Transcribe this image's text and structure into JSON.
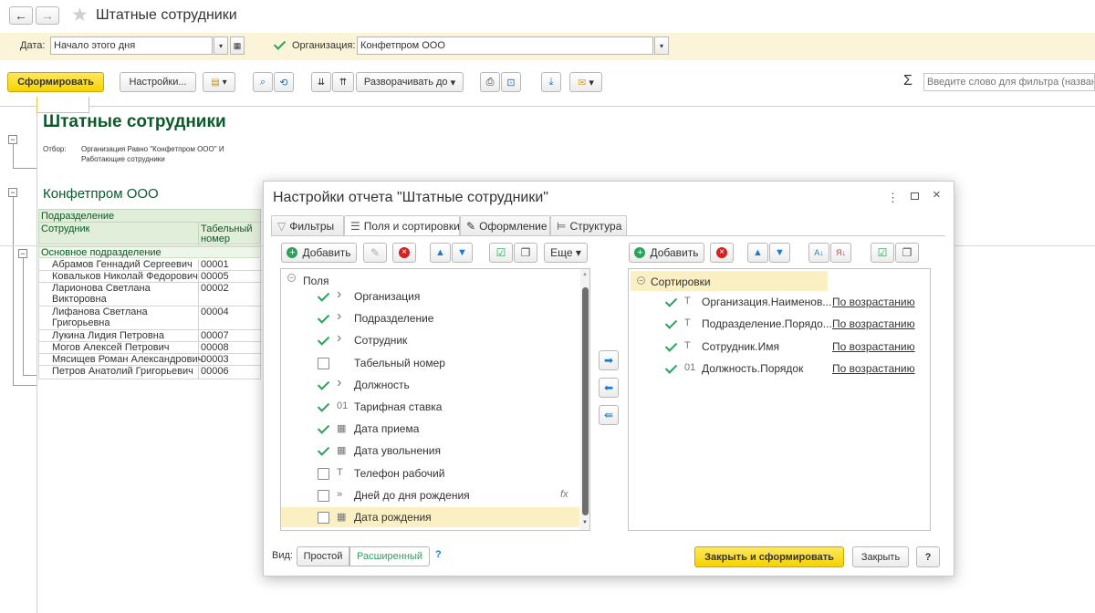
{
  "window": {
    "title": "Штатные сотрудники"
  },
  "params": {
    "date_label": "Дата:",
    "date_value": "Начало этого дня",
    "org_label": "Организация:",
    "org_value": "Конфетпром ООО"
  },
  "toolbar": {
    "generate": "Сформировать",
    "settings": "Настройки...",
    "expand_to": "Разворачивать до",
    "filter_placeholder": "Введите слово для фильтра (названи",
    "sigma": "Σ"
  },
  "report": {
    "title": "Штатные сотрудники",
    "filter_label": "Отбор:",
    "filter_line1": "Организация Равно \"Конфетпром ООО\" И",
    "filter_line2": "Работающие сотрудники",
    "org_header": "Конфетпром ООО",
    "col_dept": "Подразделение",
    "col_employee": "Сотрудник",
    "col_tabnum_1": "Табельный",
    "col_tabnum_2": "номер",
    "dept_name": "Основное подразделение",
    "rows": [
      {
        "name": "Абрамов Геннадий Сергеевич",
        "num": "00001"
      },
      {
        "name": "Ковальков Николай Федорович",
        "num": "00005"
      },
      {
        "name": "Ларионова Светлана",
        "name2": "Викторовна",
        "num": "00002"
      },
      {
        "name": "Лифанова Светлана",
        "name2": "Григорьевна",
        "num": "00004"
      },
      {
        "name": "Лукина Лидия Петровна",
        "num": "00007"
      },
      {
        "name": "Могов Алексей Петрович",
        "num": "00008"
      },
      {
        "name": "Мясищев Роман Александрович",
        "num": "00003"
      },
      {
        "name": "Петров Анатолий Григорьевич",
        "num": "00006"
      }
    ]
  },
  "dialog": {
    "title": "Настройки отчета \"Штатные сотрудники\"",
    "tabs": [
      "Фильтры",
      "Поля и сортировки",
      "Оформление",
      "Структура"
    ],
    "add": "Добавить",
    "more": "Еще",
    "fields_root": "Поля",
    "fields": [
      {
        "label": "Организация",
        "checked": true,
        "type": "›"
      },
      {
        "label": "Подразделение",
        "checked": true,
        "type": "›"
      },
      {
        "label": "Сотрудник",
        "checked": true,
        "type": "›"
      },
      {
        "label": "Табельный номер",
        "checked": false,
        "type": ""
      },
      {
        "label": "Должность",
        "checked": true,
        "type": "›"
      },
      {
        "label": "Тарифная ставка",
        "checked": true,
        "type": "01"
      },
      {
        "label": "Дата приема",
        "checked": true,
        "type": "cal"
      },
      {
        "label": "Дата увольнения",
        "checked": true,
        "type": "cal"
      },
      {
        "label": "Телефон рабочий",
        "checked": false,
        "type": "T"
      },
      {
        "label": "Дней до дня рождения",
        "checked": false,
        "type": "»"
      },
      {
        "label": "Дата рождения",
        "checked": false,
        "type": "cal"
      }
    ],
    "fx": "fx",
    "sort_root": "Сортировки",
    "sorts": [
      {
        "label": "Организация.Наименов...",
        "type": "T",
        "dir": "По возрастанию"
      },
      {
        "label": "Подразделение.Порядо...",
        "type": "T",
        "dir": "По возрастанию"
      },
      {
        "label": "Сотрудник.Имя",
        "type": "T",
        "dir": "По возрастанию"
      },
      {
        "label": "Должность.Порядок",
        "type": "01",
        "dir": "По возрастанию"
      }
    ],
    "view_label": "Вид:",
    "view_simple": "Простой",
    "view_extended": "Расширенный",
    "help": "?",
    "close_generate": "Закрыть и сформировать",
    "close": "Закрыть"
  },
  "colors": {
    "accent_yellow": "#f5d300",
    "green": "#2aa35a",
    "report_green": "#0a5a2a",
    "param_bg": "#fbf4d8"
  }
}
